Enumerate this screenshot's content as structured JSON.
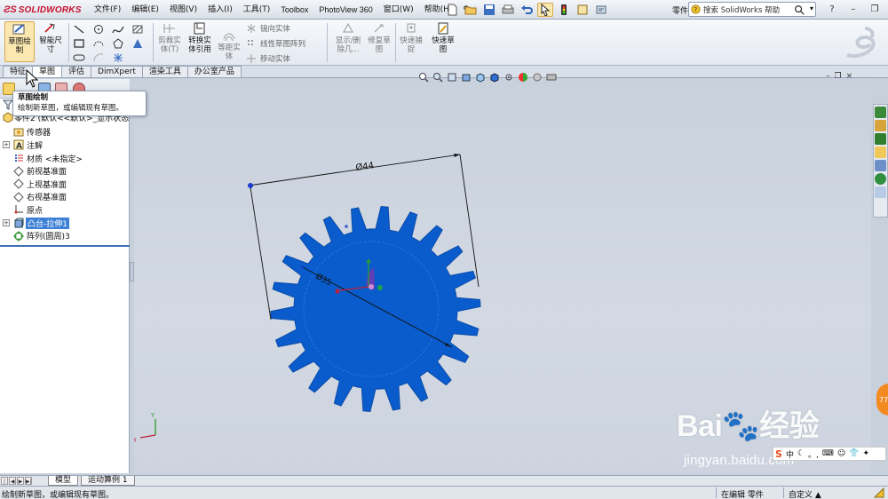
{
  "app": {
    "brand": "SOLIDWORKS",
    "document_title": "零件2 *",
    "help_search_placeholder": "搜索 SolidWorks 帮助"
  },
  "menu": [
    "文件(F)",
    "编辑(E)",
    "视图(V)",
    "插入(I)",
    "工具(T)",
    "Toolbox",
    "PhotoView 360",
    "窗口(W)",
    "帮助(H)"
  ],
  "command_manager": {
    "sketch": "草图绘\n制",
    "smart_dim": "智能尺\n寸",
    "trim": "剪裁实\n体(T)",
    "convert": "转换实\n体引用",
    "offset": "等距实\n体",
    "mirror": "镜向实体",
    "linear_pattern": "线性草图阵列",
    "move": "移动实体",
    "display_delete": "显示/删\n除几...",
    "repair": "修复草\n图",
    "quick_snaps": "快速捕\n捉",
    "rapid_sketch": "快速草\n图"
  },
  "tabs": [
    "特征",
    "草图",
    "评估",
    "DimXpert",
    "渲染工具",
    "办公室产品"
  ],
  "active_tab": "草图",
  "tooltip": {
    "title": "草图绘制",
    "body": "绘制新草图，或编辑现有草图。"
  },
  "feature_tree": {
    "root": "零件2  (默认<<默认>_显示状态",
    "items": [
      {
        "label": "传感器",
        "icon": "sensor-icon",
        "expandable": false
      },
      {
        "label": "注解",
        "icon": "annotation-icon",
        "expandable": true
      },
      {
        "label": "材质 <未指定>",
        "icon": "material-icon",
        "expandable": false
      },
      {
        "label": "前视基准面",
        "icon": "plane-icon",
        "expandable": false
      },
      {
        "label": "上视基准面",
        "icon": "plane-icon",
        "expandable": false
      },
      {
        "label": "右视基准面",
        "icon": "plane-icon",
        "expandable": false
      },
      {
        "label": "原点",
        "icon": "origin-icon",
        "expandable": false
      },
      {
        "label": "凸台-拉伸1",
        "icon": "extrude-icon",
        "expandable": true,
        "selected": true
      },
      {
        "label": "阵列(圆周)3",
        "icon": "circular-pattern-icon",
        "expandable": false
      }
    ]
  },
  "graphics": {
    "dimension_outer": "Ø44",
    "dimension_inner": "Ø35",
    "gear_color": "#0a5ccc",
    "gear_teeth": 22
  },
  "model_tabs": [
    "模型",
    "运动算例 1"
  ],
  "active_model_tab": "模型",
  "status": {
    "message": "绘制新草图，或编辑现有草图。",
    "mode": "在编辑 零件",
    "units": "自定义 ▲"
  },
  "watermark": {
    "logo": "Bai",
    "logo_suffix": "经验",
    "url": "jingyan.baidu.com"
  },
  "badge": "77"
}
